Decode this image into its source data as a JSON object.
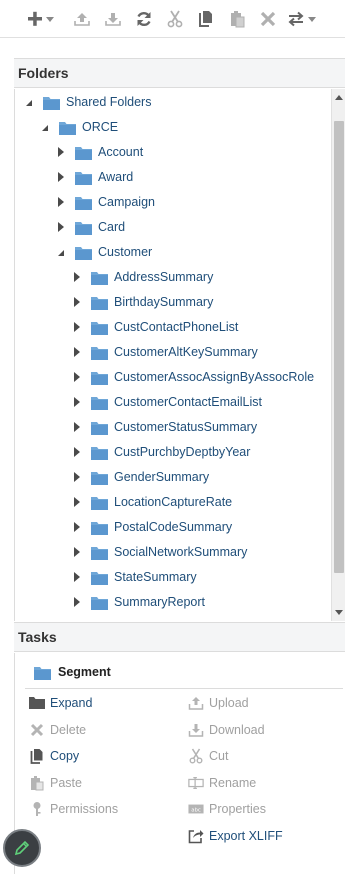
{
  "toolbar": {
    "buttons": [
      {
        "name": "new-menu",
        "icon": "plus-icon"
      },
      {
        "name": "upload",
        "icon": "upload-icon"
      },
      {
        "name": "download",
        "icon": "download-icon"
      },
      {
        "name": "refresh",
        "icon": "refresh-icon"
      },
      {
        "name": "cut",
        "icon": "scissors-icon"
      },
      {
        "name": "copy",
        "icon": "copy-icon"
      },
      {
        "name": "paste",
        "icon": "paste-icon"
      },
      {
        "name": "delete",
        "icon": "x-icon"
      },
      {
        "name": "move",
        "icon": "swap-icon"
      }
    ]
  },
  "folders": {
    "title": "Folders",
    "tree": [
      {
        "label": "Shared Folders",
        "level": 0,
        "state": "open"
      },
      {
        "label": "ORCE",
        "level": 1,
        "state": "open"
      },
      {
        "label": "Account",
        "level": 2,
        "state": "closed"
      },
      {
        "label": "Award",
        "level": 2,
        "state": "closed"
      },
      {
        "label": "Campaign",
        "level": 2,
        "state": "closed"
      },
      {
        "label": "Card",
        "level": 2,
        "state": "closed"
      },
      {
        "label": "Customer",
        "level": 2,
        "state": "open"
      },
      {
        "label": "AddressSummary",
        "level": 3,
        "state": "closed"
      },
      {
        "label": "BirthdaySummary",
        "level": 3,
        "state": "closed"
      },
      {
        "label": "CustContactPhoneList",
        "level": 3,
        "state": "closed"
      },
      {
        "label": "CustomerAltKeySummary",
        "level": 3,
        "state": "closed"
      },
      {
        "label": "CustomerAssocAssignByAssocRole",
        "level": 3,
        "state": "closed"
      },
      {
        "label": "CustomerContactEmailList",
        "level": 3,
        "state": "closed"
      },
      {
        "label": "CustomerStatusSummary",
        "level": 3,
        "state": "closed"
      },
      {
        "label": "CustPurchbyDeptbyYear",
        "level": 3,
        "state": "closed"
      },
      {
        "label": "GenderSummary",
        "level": 3,
        "state": "closed"
      },
      {
        "label": "LocationCaptureRate",
        "level": 3,
        "state": "closed"
      },
      {
        "label": "PostalCodeSummary",
        "level": 3,
        "state": "closed"
      },
      {
        "label": "SocialNetworkSummary",
        "level": 3,
        "state": "closed"
      },
      {
        "label": "StateSummary",
        "level": 3,
        "state": "closed"
      },
      {
        "label": "SummaryReport",
        "level": 3,
        "state": "closed"
      }
    ]
  },
  "tasks": {
    "title": "Tasks",
    "selected": "Segment",
    "left": [
      {
        "label": "Expand",
        "enabled": true,
        "icon": "folder-expand-icon"
      },
      {
        "label": "Delete",
        "enabled": false,
        "icon": "x-icon"
      },
      {
        "label": "Copy",
        "enabled": true,
        "icon": "copy-icon"
      },
      {
        "label": "Paste",
        "enabled": false,
        "icon": "paste-icon"
      },
      {
        "label": "Permissions",
        "enabled": false,
        "icon": "key-icon"
      }
    ],
    "right": [
      {
        "label": "Upload",
        "enabled": false,
        "icon": "upload-icon"
      },
      {
        "label": "Download",
        "enabled": false,
        "icon": "download-icon"
      },
      {
        "label": "Cut",
        "enabled": false,
        "icon": "scissors-icon"
      },
      {
        "label": "Rename",
        "enabled": false,
        "icon": "rename-icon"
      },
      {
        "label": "Properties",
        "enabled": false,
        "icon": "properties-icon"
      },
      {
        "label": "Export XLIFF",
        "enabled": true,
        "icon": "export-icon"
      }
    ]
  },
  "colors": {
    "link": "#1f4e79",
    "folder": "#6fa7d8",
    "disabled": "#a0a0a0",
    "header_bg": "#f4f5f6"
  }
}
